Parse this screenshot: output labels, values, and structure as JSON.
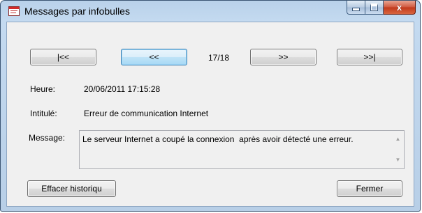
{
  "window": {
    "title": "Messages par infobulles",
    "controls": {
      "minimize": "minimize",
      "maximize": "maximize",
      "close": "x"
    }
  },
  "nav": {
    "first_label": "|<<",
    "prev_label": "<<",
    "position": "17/18",
    "next_label": ">>",
    "last_label": ">>|"
  },
  "fields": {
    "heure_label": "Heure:",
    "heure_value": "20/06/2011 17:15:28",
    "intitule_label": "Intitulé:",
    "intitule_value": "Erreur de communication Internet",
    "message_label": "Message:",
    "message_value": "Le serveur Internet a coupé la connexion  après avoir détecté une erreur."
  },
  "footer": {
    "clear_label": "Effacer historiqu",
    "close_label": "Fermer"
  },
  "scroll_icons": {
    "up": "▲",
    "down": "▼"
  }
}
